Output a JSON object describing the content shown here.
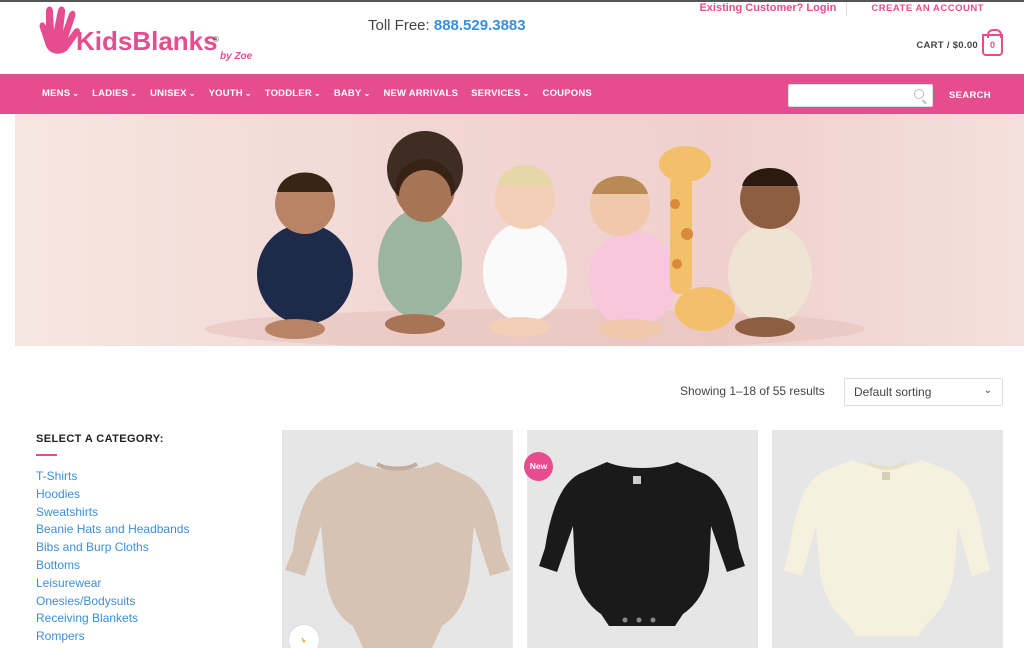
{
  "header": {
    "logo_text": "KidsBlanks",
    "logo_sub": "by Zoe",
    "toll_free_label": "Toll Free:",
    "toll_free_number": "888.529.3883",
    "existing_customer": "Existing Customer? Login",
    "create_account": "CREATE AN ACCOUNT",
    "cart_label": "CART / $0.00",
    "cart_count": "0"
  },
  "nav": {
    "items": [
      {
        "label": "MENS",
        "dropdown": true
      },
      {
        "label": "LADIES",
        "dropdown": true
      },
      {
        "label": "UNISEX",
        "dropdown": true
      },
      {
        "label": "YOUTH",
        "dropdown": true
      },
      {
        "label": "TODDLER",
        "dropdown": true
      },
      {
        "label": "BABY",
        "dropdown": true
      },
      {
        "label": "NEW ARRIVALS",
        "dropdown": false
      },
      {
        "label": "SERVICES",
        "dropdown": true
      },
      {
        "label": "COUPONS",
        "dropdown": false
      }
    ],
    "search_placeholder": "",
    "search_button": "SEARCH"
  },
  "shop": {
    "results_text": "Showing 1–18 of 55 results",
    "sort_selected": "Default sorting"
  },
  "sidebar": {
    "title": "SELECT A CATEGORY:",
    "categories": [
      "T-Shirts",
      "Hoodies",
      "Sweatshirts",
      "Beanie Hats and Headbands",
      "Bibs and Burp Cloths",
      "Bottoms",
      "Leisurewear",
      "Onesies/Bodysuits",
      "Receiving Blankets",
      "Rompers"
    ]
  },
  "products": [
    {
      "color": "#d6c3b4",
      "badge": ""
    },
    {
      "color": "#1a1a1a",
      "badge": "New"
    },
    {
      "color": "#f6f1df",
      "badge": ""
    }
  ],
  "colors": {
    "brand_pink": "#e64d8f",
    "link_blue": "#3b8fd9"
  }
}
